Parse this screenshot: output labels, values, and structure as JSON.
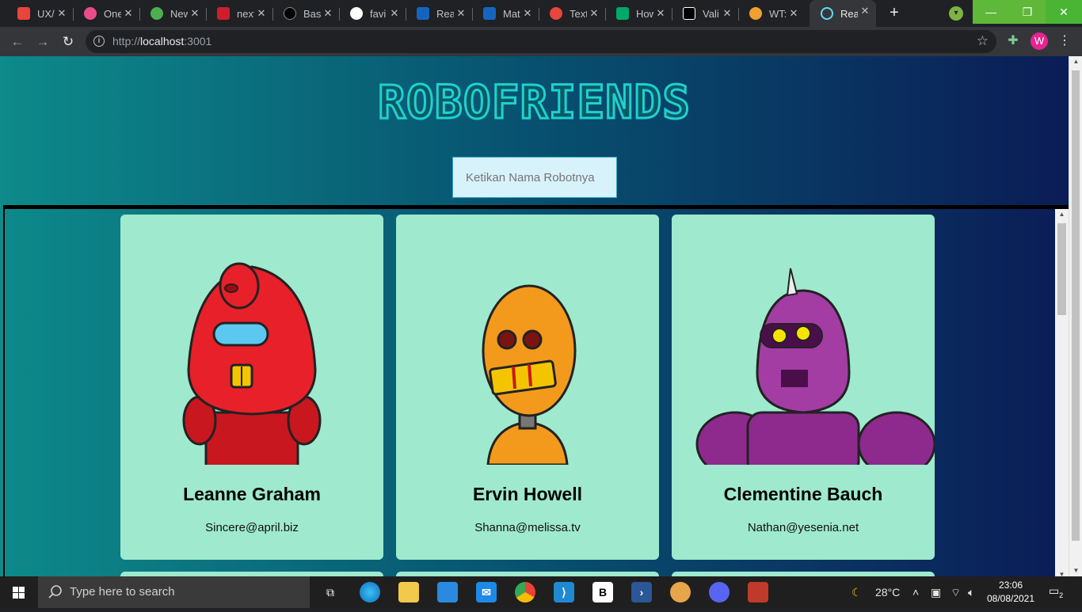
{
  "browser": {
    "tabs": [
      {
        "label": "UX/",
        "color": "#e8453c"
      },
      {
        "label": "One",
        "color": "#ea4c89"
      },
      {
        "label": "New",
        "color": "#4caf50"
      },
      {
        "label": "next",
        "color": "#cc1f2b"
      },
      {
        "label": "Basi",
        "color": "#000000"
      },
      {
        "label": "favi",
        "color": "#ffffff"
      },
      {
        "label": "Rea",
        "color": "#1565c0"
      },
      {
        "label": "Mat",
        "color": "#1565c0"
      },
      {
        "label": "Text",
        "color": "#e8453c"
      },
      {
        "label": "How",
        "color": "#00a86b"
      },
      {
        "label": "Vali",
        "color": "#000000"
      },
      {
        "label": "WT:",
        "color": "#f0a030"
      },
      {
        "label": "Rea",
        "color": "#61dafb"
      }
    ],
    "url_prefix": "http://",
    "url_host": "localhost",
    "url_rest": ":3001",
    "avatar_letter": "W"
  },
  "page": {
    "title": "ROBOFRIENDS",
    "search_placeholder": "Ketikan Nama Robotnya"
  },
  "robots": [
    {
      "name": "Leanne Graham",
      "email": "Sincere@april.biz",
      "color": "#e8202a"
    },
    {
      "name": "Ervin Howell",
      "email": "Shanna@melissa.tv",
      "color": "#f39a1d"
    },
    {
      "name": "Clementine Bauch",
      "email": "Nathan@yesenia.net",
      "color": "#8e2a8e"
    }
  ],
  "taskbar": {
    "search_text": "Type here to search",
    "temperature": "28°C",
    "time": "23:06",
    "date": "08/08/2021",
    "notification_count": "2"
  }
}
